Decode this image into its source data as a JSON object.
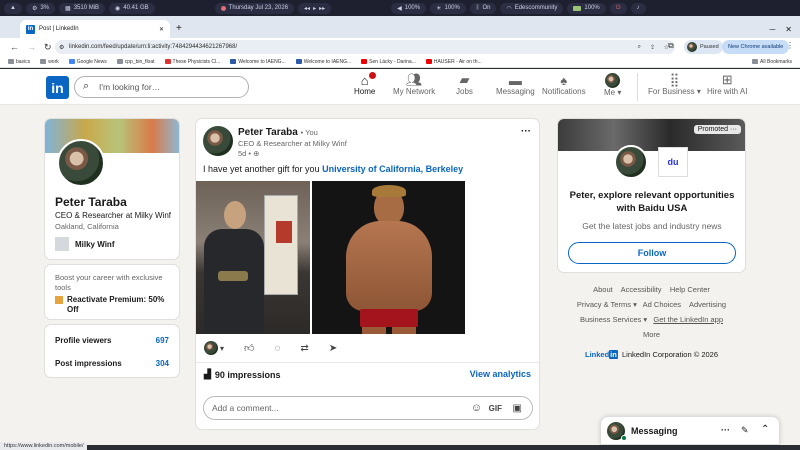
{
  "sysbar": {
    "cpu": "3%",
    "mem": "3510 MiB",
    "disk": "40.41 GB",
    "date": "Thursday Jul 23, 2026",
    "vol": "100%",
    "bright": "100%",
    "bt": "On",
    "wifi": "Edescommunity",
    "bat": "100%"
  },
  "browser": {
    "tab_title": "Post | LinkedIn",
    "url": "linkedin.com/feed/update/urn:li:activity:7484294434621267968/",
    "paused": "Paused",
    "new_chrome": "New Chrome available",
    "bookmarks": [
      "basics",
      "work",
      "Google News",
      "cpp_bin_float",
      "These Physicists Cl...",
      "Welcome to IAENG...",
      "Welcome to IAENG...",
      "Sen Lácky - Darina...",
      "HAUSER - Air on th..."
    ],
    "all_bookmarks": "All Bookmarks",
    "status_link": "https://www.linkedin.com/mobile/"
  },
  "nav": {
    "search_placeholder": "I'm looking for…",
    "items": [
      "Home",
      "My Network",
      "Jobs",
      "Messaging",
      "Notifications",
      "Me",
      "For Business",
      "Hire with AI"
    ],
    "logo": "in"
  },
  "profile": {
    "name": "Peter Taraba",
    "headline": "CEO & Researcher at Milky Winf",
    "location": "Oakland, California",
    "company": "Milky Winf",
    "premium_text": "Boost your career with exclusive tools",
    "premium_cta": "Reactivate Premium: 50% Off",
    "viewers_label": "Profile viewers",
    "viewers": "697",
    "impressions_label": "Post impressions",
    "impressions": "304"
  },
  "post": {
    "author": "Peter Taraba",
    "degree": "• You",
    "headline": "CEO & Researcher at Milky Winf",
    "time": "5d",
    "text": "I have yet another gift for you",
    "mention": "University of California, Berkeley",
    "impressions": "90 impressions",
    "analytics": "View analytics",
    "comment_placeholder": "Add a comment...",
    "gif": "GIF"
  },
  "ad": {
    "promoted": "Promoted",
    "brand": "du",
    "title": "Peter, explore relevant opportunities with Baidu USA",
    "body": "Get the latest jobs and industry news",
    "cta": "Follow"
  },
  "footer": {
    "links": [
      "About",
      "Accessibility",
      "Help Center",
      "Privacy & Terms",
      "Ad Choices",
      "Advertising",
      "Business Services",
      "Get the LinkedIn app",
      "More"
    ],
    "copyright": "LinkedIn Corporation © 2026",
    "brand": "Linked"
  },
  "messaging": {
    "label": "Messaging"
  }
}
